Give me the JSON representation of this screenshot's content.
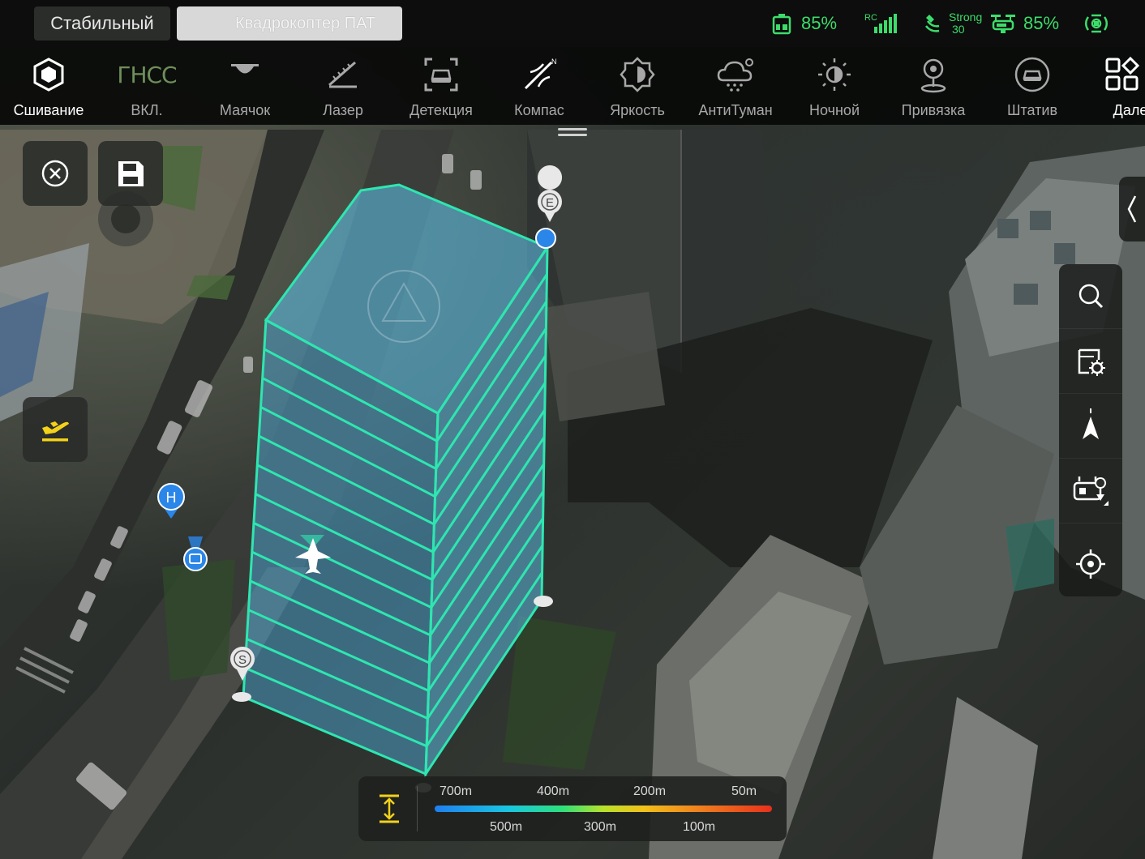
{
  "topbar": {
    "mode_label": "Стабильный",
    "device_label": "Квадрокоптер ПАТ",
    "battery_percent": "85%",
    "rc_label": "RC",
    "signal_strength": "Strong",
    "signal_value": "30",
    "drone_battery_percent": "85%",
    "colors": {
      "accent": "#3ddc6b"
    }
  },
  "toolbar": {
    "items": [
      {
        "label": "Сшивание",
        "icon": "stitch-cube-icon",
        "active": true
      },
      {
        "label": "ВКЛ.",
        "icon": "gnss-icon",
        "icon_text": "ГНСС"
      },
      {
        "label": "Маячок",
        "icon": "beacon-icon"
      },
      {
        "label": "Лазер",
        "icon": "laser-ruler-icon"
      },
      {
        "label": "Детекция",
        "icon": "detection-icon"
      },
      {
        "label": "Компас",
        "icon": "compass-icon"
      },
      {
        "label": "Яркость",
        "icon": "brightness-icon"
      },
      {
        "label": "АнтиТуман",
        "icon": "antifog-icon"
      },
      {
        "label": "Ночной",
        "icon": "night-icon"
      },
      {
        "label": "Привязка",
        "icon": "anchor-pin-icon"
      },
      {
        "label": "Штатив",
        "icon": "tripod-icon"
      },
      {
        "label": "Далее",
        "icon": "more-grid-icon"
      }
    ]
  },
  "map": {
    "markers": {
      "start": "S",
      "end": "E",
      "home": "H"
    },
    "colors": {
      "route": "#2ee6b0",
      "volume": "#5fc6f0",
      "home": "#2a86e8"
    }
  },
  "left_controls": {
    "close": "close-icon",
    "save": "save-icon",
    "takeoff": "takeoff-icon"
  },
  "right_panel": {
    "items": [
      "search-icon",
      "map-settings-icon",
      "north-arrow-icon",
      "rc-location-icon",
      "locate-target-icon"
    ]
  },
  "legend": {
    "top_labels": [
      "700m",
      "400m",
      "200m",
      "50m"
    ],
    "bottom_labels": [
      "500m",
      "300m",
      "100m"
    ]
  }
}
